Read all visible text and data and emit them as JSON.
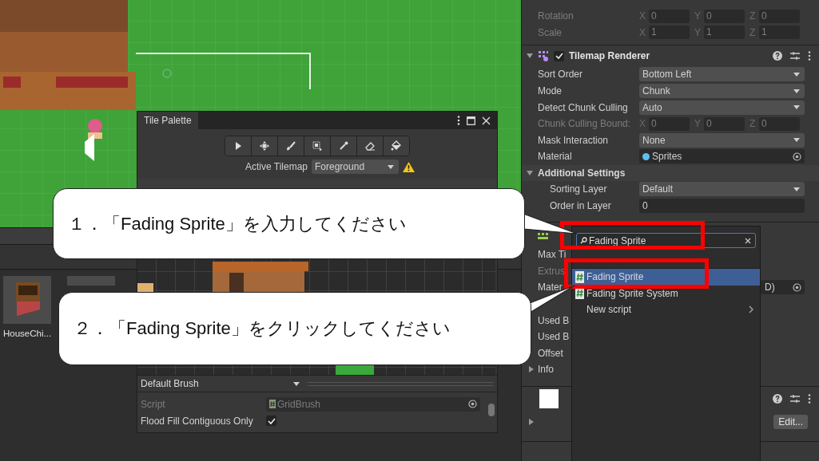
{
  "project": {
    "assets": [
      {
        "label": "HouseChi...",
        "kind": "house"
      },
      {
        "kind": "blank"
      }
    ]
  },
  "tile_palette": {
    "title": "Tile Palette",
    "tools": [
      {
        "kind": "select"
      },
      {
        "kind": "move"
      },
      {
        "kind": "paint"
      },
      {
        "kind": "box"
      },
      {
        "kind": "picker"
      },
      {
        "kind": "erase"
      },
      {
        "kind": "fill"
      }
    ],
    "active_tilemap_label": "Active Tilemap",
    "active_tilemap": "Foreground",
    "warning": true,
    "brush": "Default Brush",
    "properties": [
      {
        "kind": "object",
        "label": "Script",
        "value": "GridBrush",
        "disabled": true
      },
      {
        "kind": "checkbox",
        "label": "Flood Fill Contiguous Only",
        "checked": true,
        "disabled": false
      }
    ]
  },
  "inspector": {
    "transform_rows": [
      {
        "label": "Rotation",
        "values": [
          {
            "axis": "X",
            "value": "0"
          },
          {
            "axis": "Y",
            "value": "0"
          },
          {
            "axis": "Z",
            "value": "0"
          }
        ]
      },
      {
        "label": "Scale",
        "values": [
          {
            "axis": "X",
            "value": "1"
          },
          {
            "axis": "Y",
            "value": "1"
          },
          {
            "axis": "Z",
            "value": "1"
          }
        ]
      }
    ],
    "renderer": {
      "title": "Tilemap Renderer",
      "enabled": true,
      "expanded": true,
      "fields": [
        {
          "kind": "dropdown",
          "label": "Sort Order",
          "value": "Bottom Left",
          "disabled": false
        },
        {
          "kind": "dropdown",
          "label": "Mode",
          "value": "Chunk",
          "disabled": false
        },
        {
          "kind": "dropdown",
          "label": "Detect Chunk Culling",
          "value": "Auto",
          "disabled": false
        },
        {
          "kind": "vector",
          "label": "Chunk Culling Bound:",
          "values": [
            {
              "axis": "X",
              "value": "0"
            },
            {
              "axis": "Y",
              "value": "0"
            },
            {
              "axis": "Z",
              "value": "0"
            }
          ],
          "disabled": true
        },
        {
          "kind": "dropdown",
          "label": "Mask Interaction",
          "value": "None",
          "disabled": false
        },
        {
          "kind": "object",
          "label": "Material",
          "value": "Sprites",
          "disabled": false
        }
      ],
      "additional": {
        "title": "Additional Settings",
        "expanded": true,
        "fields": [
          {
            "kind": "dropdown",
            "label": "Sorting Layer",
            "value": "Default"
          },
          {
            "kind": "number",
            "label": "Order in Layer",
            "value": "0"
          }
        ]
      }
    },
    "collider": {
      "rows": [
        {
          "kind": "field",
          "label": "Max Ti",
          "disabled": false
        },
        {
          "kind": "field",
          "label": "Extrus",
          "disabled": true
        },
        {
          "kind": "field",
          "label": "Mater",
          "value": "D)",
          "disabled": false
        },
        {
          "kind": "covered"
        },
        {
          "kind": "field",
          "label": "Used B",
          "disabled": false
        },
        {
          "kind": "field",
          "label": "Used B",
          "disabled": false
        },
        {
          "kind": "field",
          "label": "Offset",
          "disabled": false
        },
        {
          "kind": "foldout",
          "label": "Info",
          "disabled": false
        }
      ]
    },
    "sprite": {
      "button": "Edit..."
    }
  },
  "popup": {
    "search": "Fading Sprite",
    "items": [
      {
        "kind": "script",
        "label": "Fading Sprite",
        "selected": true
      },
      {
        "kind": "script",
        "label": "Fading Sprite System",
        "selected": false
      },
      {
        "kind": "submenu",
        "label": "New script",
        "selected": false
      }
    ]
  },
  "callouts": [
    {
      "text": "１．「Fading Sprite」を入力してください"
    },
    {
      "text": "２．「Fading Sprite」をクリックしてください"
    }
  ]
}
